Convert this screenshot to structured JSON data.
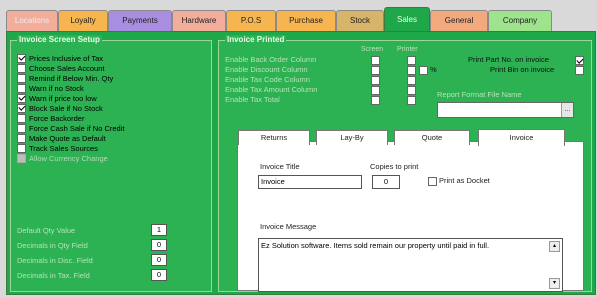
{
  "tabs": [
    {
      "label": "Locations",
      "color": "#f2ad9b",
      "muted": true
    },
    {
      "label": "Loyalty",
      "color": "#f7b54f"
    },
    {
      "label": "Payments",
      "color": "#a98de0"
    },
    {
      "label": "Hardware",
      "color": "#f2ad9b"
    },
    {
      "label": "P.O.S",
      "color": "#f7b54f"
    },
    {
      "label": "Purchase",
      "color": "#f7b54f"
    },
    {
      "label": "Stock",
      "color": "#d6b46a"
    },
    {
      "label": "Sales",
      "color": "#1fa84a",
      "active": true
    },
    {
      "label": "General",
      "color": "#f2a97e"
    },
    {
      "label": "Company",
      "color": "#9ee48d"
    }
  ],
  "invoice_setup": {
    "title": "Invoice Screen Setup",
    "options": [
      {
        "label": "Prices Inclusive of Tax",
        "checked": true
      },
      {
        "label": "Choose Sales Account",
        "checked": false
      },
      {
        "label": "Remind if Below Min. Qty",
        "checked": false
      },
      {
        "label": "Warn if no Stock",
        "checked": false
      },
      {
        "label": "Warn if price too low",
        "checked": true
      },
      {
        "label": "Block Sale if No Stock",
        "checked": true
      },
      {
        "label": "Force Backorder",
        "checked": false
      },
      {
        "label": "Force Cash Sale if No Credit",
        "checked": false
      },
      {
        "label": "Make Quote as Default",
        "checked": false
      },
      {
        "label": "Track Sales Sources",
        "checked": false
      },
      {
        "label": "Allow Currency Change",
        "checked": false,
        "disabled": true
      }
    ],
    "fields": [
      {
        "label": "Default Qty Value",
        "value": "1"
      },
      {
        "label": "Decimals in Qty Field",
        "value": "0"
      },
      {
        "label": "Decimals in Disc. Field",
        "value": "0"
      },
      {
        "label": "Decimals in Tax. Field",
        "value": "0"
      }
    ]
  },
  "invoice_printed": {
    "title": "Invoice Printed",
    "col_screen": "Screen",
    "col_printer": "Printer",
    "rows": [
      {
        "label": "Enable Back Order Column"
      },
      {
        "label": "Enable Discount Column"
      },
      {
        "label": "Enable Tax Code Column"
      },
      {
        "label": "Enable Tax Amount Column"
      },
      {
        "label": "Enable Tax Total"
      }
    ],
    "percent_label": "%",
    "print_part_no": {
      "label": "Print Part No. on invoice",
      "checked": true
    },
    "print_bin": {
      "label": "Print Bin on invoice",
      "checked": false
    },
    "report_format": {
      "label": "Report Format File Name",
      "value": "",
      "browse": "..."
    }
  },
  "inner_tabs": [
    "Returns",
    "Lay-By",
    "Quote",
    "Invoice"
  ],
  "invoice_tab": {
    "title_label": "Invoice Title",
    "title_value": "Invoice",
    "copies_label": "Copies to print",
    "copies_value": "0",
    "docket_label": "Print as Docket",
    "message_label": "Invoice Message",
    "message_value": "Ez Solution software. Items sold remain our property until paid in full."
  }
}
